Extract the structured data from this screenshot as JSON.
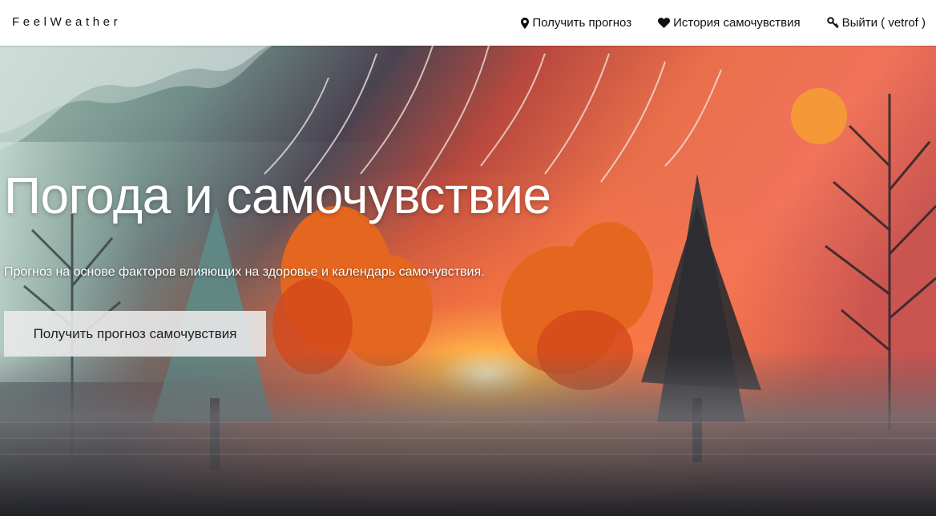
{
  "navbar": {
    "brand": "FeelWeather",
    "links": [
      {
        "label": "Получить прогноз",
        "icon": "map-marker-icon"
      },
      {
        "label": "История самочувствия",
        "icon": "heart-icon"
      },
      {
        "label": "Выйти ( vetrof )",
        "icon": "key-icon"
      }
    ]
  },
  "hero": {
    "title": "Погода и самочувствие",
    "subtitle": "Прогноз на основе факторов влияющих на здоровье и календарь самочувствия.",
    "button_label": "Получить прогноз самочувствия",
    "background_image": "painted-autumn-forest-sunset"
  },
  "colors": {
    "navbar_bg": "#ffffff",
    "text_dark": "#111111",
    "hero_text": "#ffffff",
    "button_bg": "#ebebeb"
  }
}
